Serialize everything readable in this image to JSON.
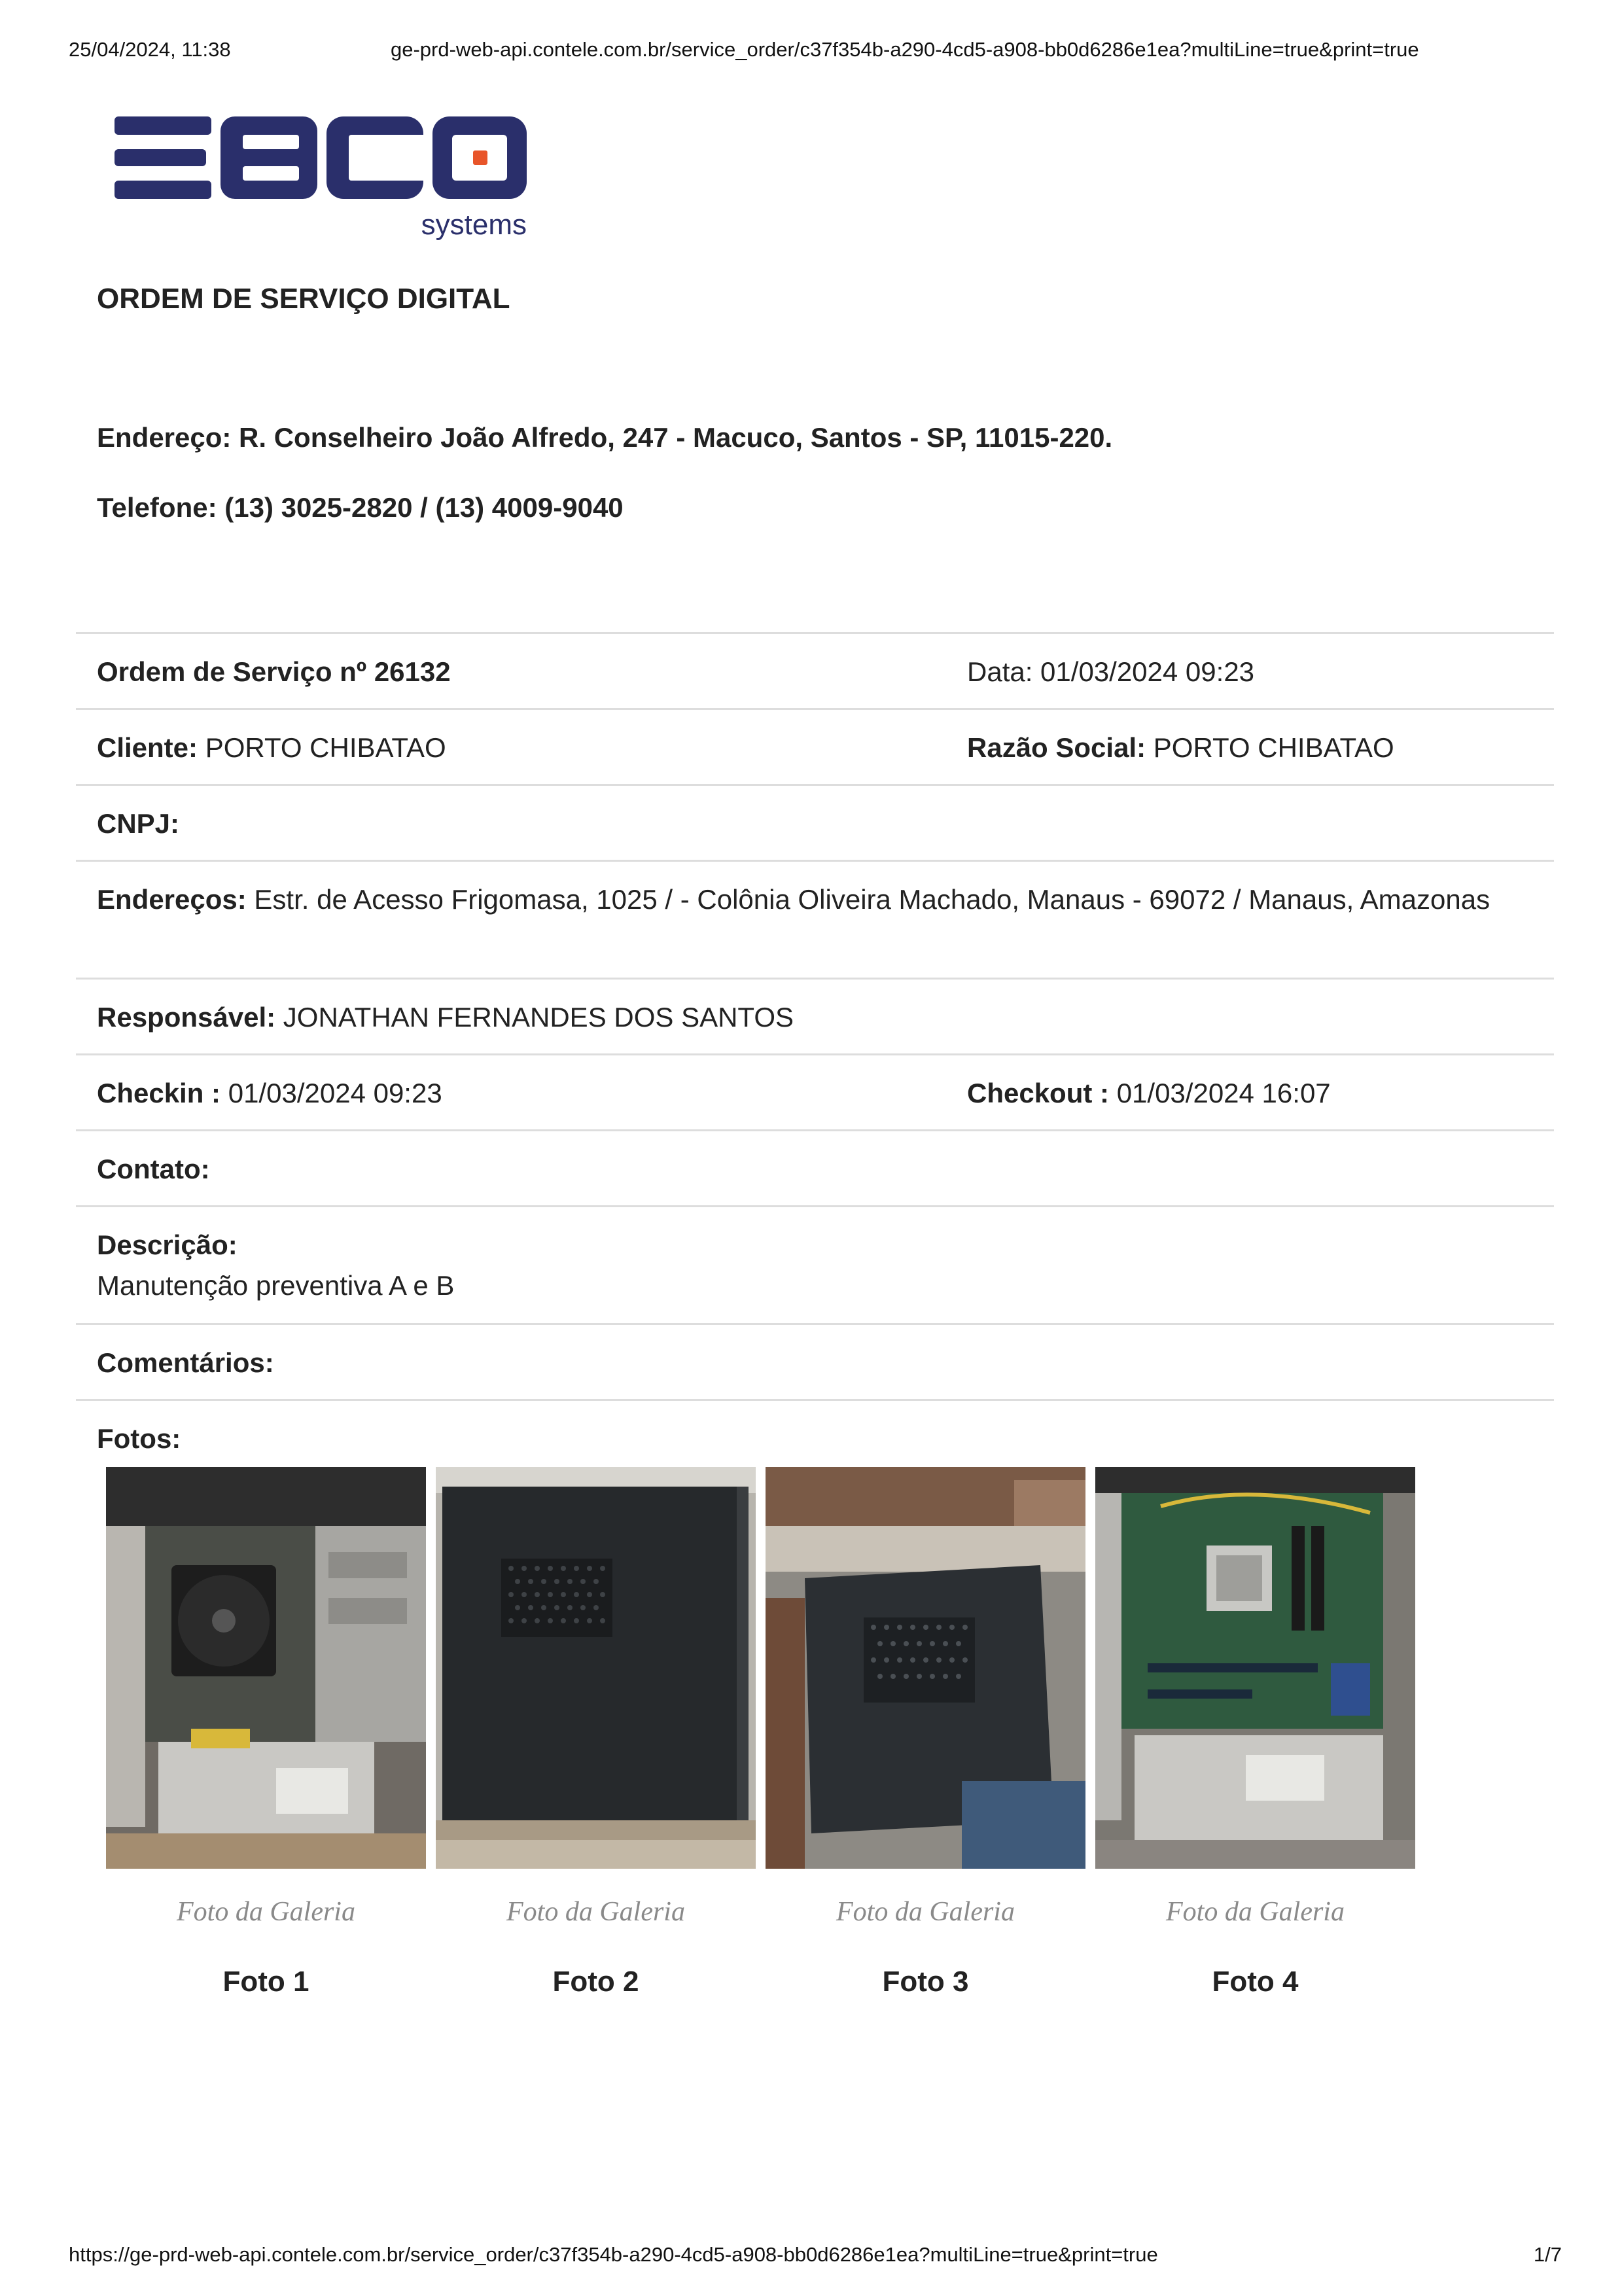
{
  "print_header": {
    "datetime": "25/04/2024, 11:38",
    "url": "ge-prd-web-api.contele.com.br/service_order/c37f354b-a290-4cd5-a908-bb0d6286e1ea?multiLine=true&print=true"
  },
  "print_footer": {
    "url": "https://ge-prd-web-api.contele.com.br/service_order/c37f354b-a290-4cd5-a908-bb0d6286e1ea?multiLine=true&print=true",
    "page": "1/7"
  },
  "logo": {
    "wordmark": "EBCO",
    "tagline": "systems",
    "brand_color": "#2a2f6b",
    "accent_color": "#e8552a"
  },
  "document": {
    "title": "ORDEM DE SERVIÇO DIGITAL",
    "company_address": "Endereço: R. Conselheiro João Alfredo, 247 - Macuco, Santos - SP, 11015-220.",
    "company_phone": "Telefone: (13) 3025-2820 / (13) 4009-9040"
  },
  "order": {
    "number_label": "Ordem de Serviço nº 26132",
    "date": "Data: 01/03/2024 09:23",
    "client_label": "Cliente:",
    "client_value": "PORTO CHIBATAO",
    "razao_label": "Razão Social:",
    "razao_value": "PORTO CHIBATAO",
    "cnpj_label": "CNPJ:",
    "enderecos_label": "Endereços:",
    "enderecos_value": "Estr. de Acesso Frigomasa, 1025 / - Colônia Oliveira Machado, Manaus - 69072 / Manaus, Amazonas",
    "responsavel_label": "Responsável:",
    "responsavel_value": "JONATHAN FERNANDES DOS SANTOS",
    "checkin_label": "Checkin :",
    "checkin_value": "01/03/2024 09:23",
    "checkout_label": "Checkout :",
    "checkout_value": "01/03/2024 16:07",
    "contato_label": "Contato:",
    "descricao_label": "Descrição:",
    "descricao_value": "Manutenção preventiva A e B",
    "comentarios_label": "Comentários:",
    "fotos_label": "Fotos:"
  },
  "photos": [
    {
      "caption": "Foto da Galeria",
      "label": "Foto 1",
      "subject": "open-pc-case-fan"
    },
    {
      "caption": "Foto da Galeria",
      "label": "Foto 2",
      "subject": "pc-side-panel"
    },
    {
      "caption": "Foto da Galeria",
      "label": "Foto 3",
      "subject": "hand-holding-panel"
    },
    {
      "caption": "Foto da Galeria",
      "label": "Foto 4",
      "subject": "open-pc-motherboard"
    }
  ]
}
